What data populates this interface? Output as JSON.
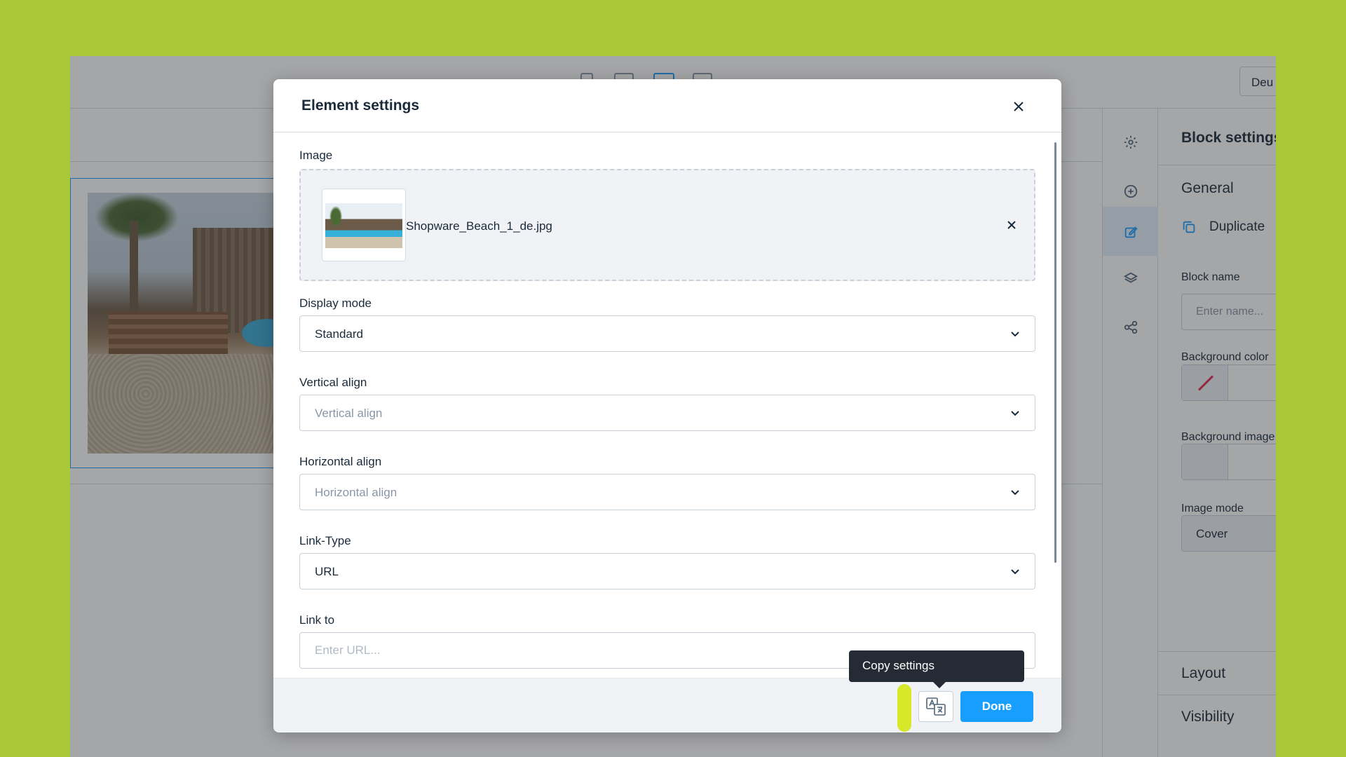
{
  "app": {
    "language_switch": "Deu",
    "block_settings": {
      "title": "Block settings",
      "general_label": "General",
      "duplicate_label": "Duplicate",
      "block_name_label": "Block name",
      "block_name_placeholder": "Enter name...",
      "background_color_label": "Background color",
      "background_image_label": "Background image",
      "image_mode_label": "Image mode",
      "image_mode_value": "Cover",
      "layout_label": "Layout",
      "visibility_label": "Visibility"
    },
    "sidebar_icons": [
      "gear-icon",
      "plus-circle-icon",
      "edit-icon",
      "layers-icon",
      "share-icon"
    ]
  },
  "modal": {
    "title": "Element settings",
    "image_label": "Image",
    "image_file": "Shopware_Beach_1_de.jpg",
    "display_mode_label": "Display mode",
    "display_mode_value": "Standard",
    "vertical_align_label": "Vertical align",
    "vertical_align_placeholder": "Vertical align",
    "horizontal_align_label": "Horizontal align",
    "horizontal_align_placeholder": "Horizontal align",
    "link_type_label": "Link-Type",
    "link_type_value": "URL",
    "link_to_label": "Link to",
    "link_to_placeholder": "Enter URL...",
    "done_label": "Done",
    "tooltip": "Copy settings"
  },
  "colors": {
    "page_background": "#a8c838",
    "accent": "#189eff",
    "highlight": "#d7e82a",
    "tooltip_bg": "#242b35"
  }
}
